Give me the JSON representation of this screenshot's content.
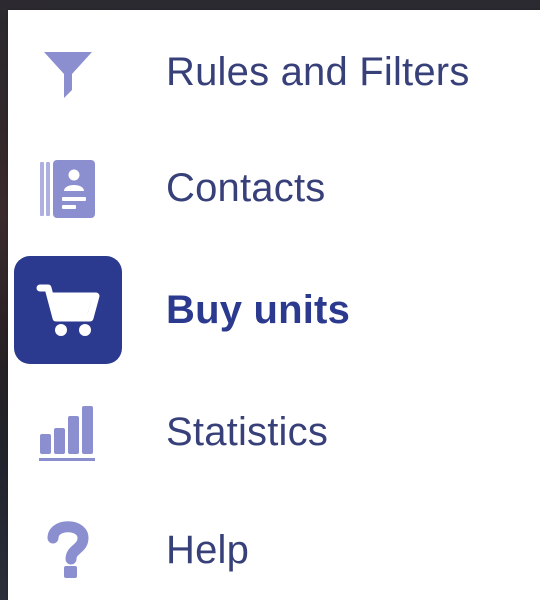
{
  "theme": {
    "icon_color": "#8b8fd0",
    "label_color": "#38407a",
    "active_bg": "#2b3a8f",
    "active_icon_color": "#ffffff"
  },
  "menu": {
    "items": [
      {
        "label": "Rules and Filters",
        "icon": "filter-icon",
        "active": false
      },
      {
        "label": "Contacts",
        "icon": "contacts-icon",
        "active": false
      },
      {
        "label": "Buy units",
        "icon": "cart-icon",
        "active": true
      },
      {
        "label": "Statistics",
        "icon": "bar-chart-icon",
        "active": false
      },
      {
        "label": "Help",
        "icon": "help-icon",
        "active": false
      }
    ]
  }
}
